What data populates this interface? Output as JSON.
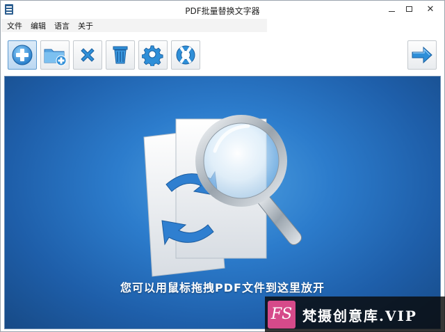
{
  "window": {
    "title": "PDF批量替换文字器"
  },
  "menu": {
    "items": [
      "文件",
      "编辑",
      "语言",
      "关于"
    ]
  },
  "toolbar": {
    "buttons": [
      {
        "name": "add-file",
        "icon": "plus-circle-icon"
      },
      {
        "name": "add-folder",
        "icon": "folder-add-icon"
      },
      {
        "name": "remove",
        "icon": "x-icon"
      },
      {
        "name": "clear",
        "icon": "trash-icon"
      },
      {
        "name": "settings",
        "icon": "gear-icon"
      },
      {
        "name": "help",
        "icon": "lifebuoy-icon"
      },
      {
        "name": "next",
        "icon": "arrow-right-icon"
      }
    ]
  },
  "dropzone": {
    "hint": "您可以用鼠标拖拽PDF文件到这里放开"
  },
  "watermark": {
    "logo_text": "FS",
    "text": "梵摄创意库.VIP"
  },
  "colors": {
    "accent": "#2f8fd8",
    "dropzone_bg": "#2c7ccc",
    "watermark_pink": "#d64a8a"
  }
}
